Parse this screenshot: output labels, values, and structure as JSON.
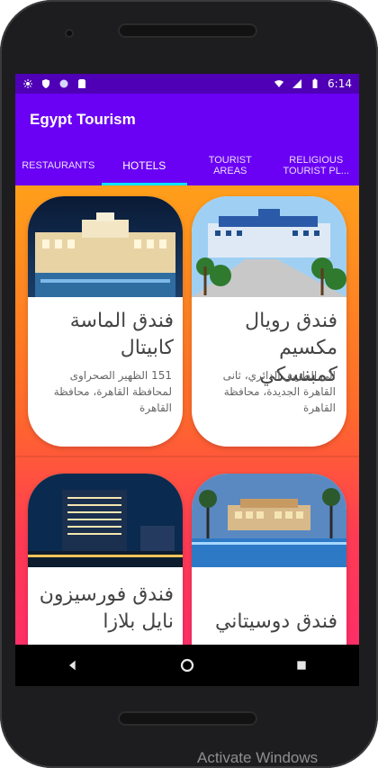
{
  "status_bar": {
    "time": "6:14",
    "left_icons": [
      "settings-icon",
      "shield-icon",
      "circle-icon",
      "sd-card-icon"
    ],
    "right_icons": [
      "wifi-icon",
      "signal-icon",
      "battery-icon"
    ]
  },
  "app": {
    "title": "Egypt Tourism",
    "accent": "#6a00f4",
    "status_color": "#4f00b6",
    "tab_indicator_color": "#00e5ff"
  },
  "tabs": [
    {
      "label": "RESTAURANTS",
      "active": false
    },
    {
      "label": "HOTELS",
      "active": true
    },
    {
      "label": "TOURIST AREAS",
      "active": false
    },
    {
      "label": "RELIGIOUS TOURIST PL...",
      "active": false
    }
  ],
  "hotels": [
    {
      "title": "فندق الماسة كابيتال",
      "address": "151 الظهير الصحراوى لمحافظة القاهرة، محافظة القاهرة"
    },
    {
      "title": "فندق رويال مكسيم كمبنسكي",
      "address": "الى الطريق الدائري، ثانى القاهرة الجديدة، محافظة القاهرة"
    },
    {
      "title": "فندق فورسيزون نايل بلازا",
      "address": ""
    },
    {
      "title": "فندق دوسيتاني",
      "address": ""
    }
  ],
  "watermark": "Activate Windows"
}
